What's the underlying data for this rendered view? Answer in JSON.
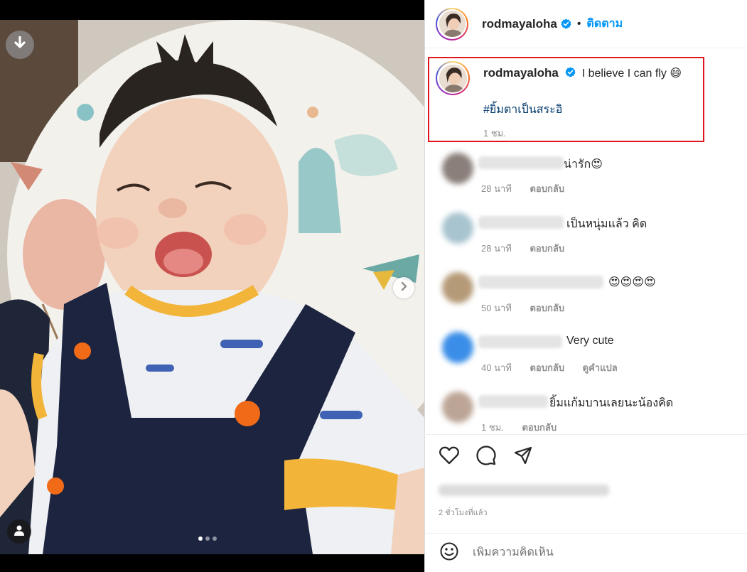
{
  "post": {
    "username": "rodmayaloha",
    "follow_label": "ติดตาม",
    "separator": "•",
    "caption": {
      "username": "rodmayaloha",
      "text": "I believe I can fly 😄",
      "hashtag": "#ยิ้มตาเป็นสระอิ",
      "time": "1 ชม."
    },
    "comments": [
      {
        "text": "น่ารัก😍",
        "time": "28 นาที",
        "reply": "ตอบกลับ",
        "translate": ""
      },
      {
        "text": "เป็นหนุ่มแล้ว คิด",
        "time": "28 นาที",
        "reply": "ตอบกลับ",
        "translate": ""
      },
      {
        "text": "😍😍😍😍",
        "time": "50 นาที",
        "reply": "ตอบกลับ",
        "translate": ""
      },
      {
        "text": "Very cute",
        "time": "40 นาที",
        "reply": "ตอบกลับ",
        "translate": "ดูคำแปล"
      },
      {
        "text": "ยิ้มแก้มบานเลยนะน้องคิด",
        "time": "1 ชม.",
        "reply": "ตอบกลับ",
        "translate": ""
      }
    ],
    "posted_ago": "2 ชั่วโมงที่แล้ว",
    "add_comment_placeholder": "เพิ่มความคิดเห็น",
    "carousel": {
      "total": 3,
      "active": 1
    }
  },
  "icons": {
    "download": "download-arrow-icon",
    "next": "chevron-right-icon",
    "user_tag": "person-icon",
    "verified": "verified-badge-icon",
    "like": "heart-icon",
    "comment": "speech-bubble-icon",
    "share": "paper-plane-icon",
    "emoji": "smiley-icon"
  },
  "colors": {
    "accent": "#0095f6",
    "hashtag": "#00376b",
    "highlight_border": "#e0151d",
    "muted": "#8e8e8e"
  }
}
